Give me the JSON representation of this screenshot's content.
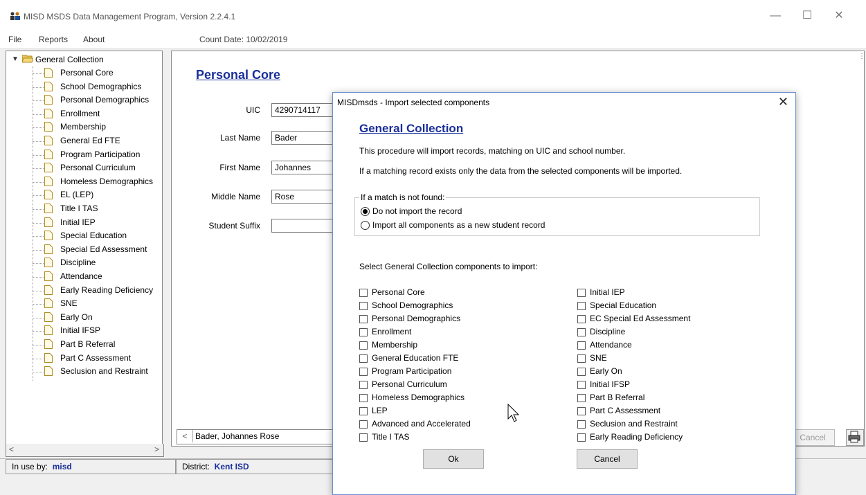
{
  "window": {
    "title": "MISD MSDS Data Management Program,  Version 2.2.4.1",
    "minimize_glyph": "—",
    "maximize_glyph": "☐",
    "close_glyph": "✕"
  },
  "menu": {
    "items": [
      "File",
      "Reports",
      "About"
    ],
    "count_date": "Count Date: 10/02/2019"
  },
  "tree": {
    "root": "General Collection",
    "items": [
      "Personal Core",
      "School Demographics",
      "Personal Demographics",
      "Enrollment",
      "Membership",
      "General Ed FTE",
      "Program Participation",
      "Personal Curriculum",
      "Homeless Demographics",
      "EL (LEP)",
      "Title I TAS",
      "Initial IEP",
      "Special Education",
      "Special Ed Assessment",
      "Discipline",
      "Attendance",
      "Early Reading Deficiency",
      "SNE",
      "Early On",
      "Initial IFSP",
      "Part B Referral",
      "Part C Assessment",
      "Seclusion and Restraint"
    ],
    "scroll_left": "<",
    "scroll_right": ">"
  },
  "form": {
    "title": "Personal Core",
    "fields": [
      {
        "label": "UIC",
        "value": "4290714117"
      },
      {
        "label": "Last Name",
        "value": "Bader"
      },
      {
        "label": "First Name",
        "value": "Johannes"
      },
      {
        "label": "Middle Name",
        "value": "Rose"
      },
      {
        "label": "Student Suffix",
        "value": ""
      }
    ],
    "nav_prev": "<",
    "nav_text": "Bader, Johannes Rose",
    "cancel_label": "Cancel"
  },
  "status": {
    "inuse_label": "In use by:",
    "inuse_value": "misd",
    "district_label": "District:",
    "district_value": "Kent ISD"
  },
  "dialog": {
    "title": "MISDmsds - Import selected components",
    "close_glyph": "✕",
    "heading": "General Collection",
    "line1": "This procedure will import records, matching on UIC and school number.",
    "line2": "If a matching record exists only the data from the selected components will be imported.",
    "group_label": "If a match is not found:",
    "radio1": "Do not import the record",
    "radio2": "Import all components as a new student record",
    "select_label": "Select General Collection components to import:",
    "left_components": [
      "Personal Core",
      "School Demographics",
      "Personal Demographics",
      "Enrollment",
      "Membership",
      "General Education FTE",
      "Program Participation",
      "Personal Curriculum",
      "Homeless Demographics",
      "LEP",
      "Advanced and Accelerated",
      "Title I TAS"
    ],
    "right_components": [
      "Initial IEP",
      "Special Education",
      "EC Special Ed Assessment",
      "Discipline",
      "Attendance",
      "SNE",
      "Early On",
      "Initial IFSP",
      "Part B Referral",
      "Part C Assessment",
      "Seclusion and Restraint",
      "Early Reading Deficiency"
    ],
    "ok_label": "Ok",
    "cancel_label": "Cancel"
  }
}
